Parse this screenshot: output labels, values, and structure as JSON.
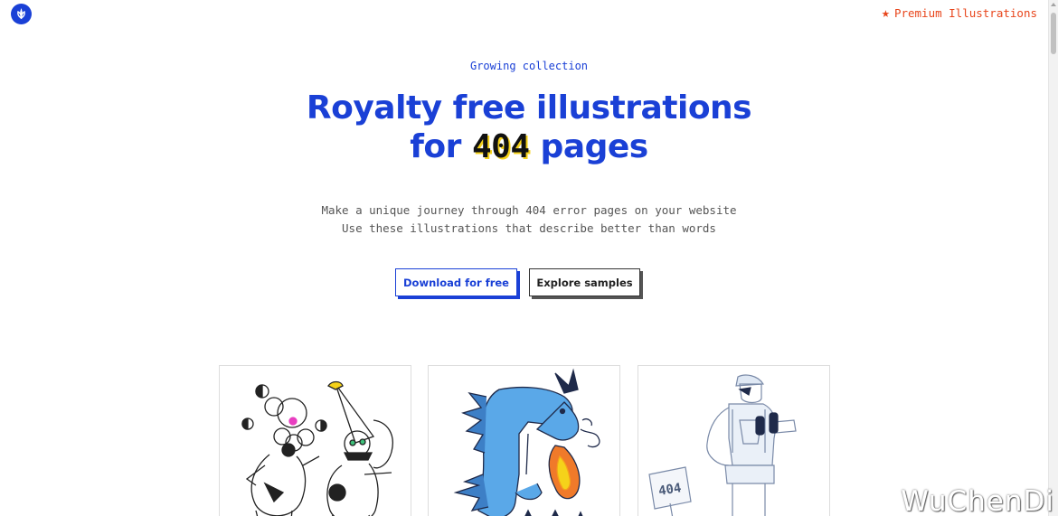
{
  "header": {
    "logo_icon": "leaf-icon",
    "premium_link": {
      "icon": "star-icon",
      "label": "Premium Illustrations"
    }
  },
  "hero": {
    "eyebrow": "Growing collection",
    "title_line1": "Royalty free illustrations",
    "title_line2_prefix": "for",
    "title_highlight": "404",
    "title_line2_suffix": "pages",
    "subtitle_line1": "Make a unique journey through 404 error pages on your website",
    "subtitle_line2": "Use these illustrations that describe better than words"
  },
  "actions": {
    "download_label": "Download for free",
    "explore_label": "Explore samples"
  },
  "cards": [
    {
      "name": "clowns-juggling"
    },
    {
      "name": "blue-dragon"
    },
    {
      "name": "tourist-binoculars",
      "sign_text": "404"
    }
  ],
  "watermark": "WuChenDi",
  "colors": {
    "brand_blue": "#1a40d6",
    "accent_orange": "#e8451b",
    "highlight_yellow": "#f5d21a"
  }
}
